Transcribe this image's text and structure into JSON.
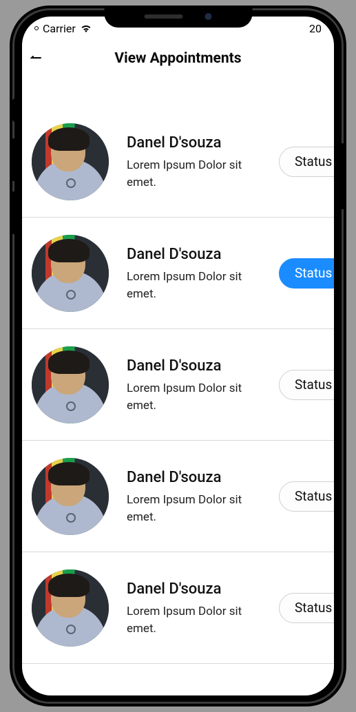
{
  "status_bar": {
    "carrier": "Carrier",
    "battery": "20"
  },
  "header": {
    "title": "View Appointments"
  },
  "status_label": "Status",
  "appointments": [
    {
      "name": "Danel D'souza",
      "desc": "Lorem Ipsum Dolor sit emet.",
      "active": false
    },
    {
      "name": "Danel D'souza",
      "desc": "Lorem Ipsum Dolor sit emet.",
      "active": true
    },
    {
      "name": "Danel D'souza",
      "desc": "Lorem Ipsum Dolor sit emet.",
      "active": false
    },
    {
      "name": "Danel D'souza",
      "desc": "Lorem Ipsum Dolor sit emet.",
      "active": false
    },
    {
      "name": "Danel D'souza",
      "desc": "Lorem Ipsum Dolor sit emet.",
      "active": false
    }
  ]
}
